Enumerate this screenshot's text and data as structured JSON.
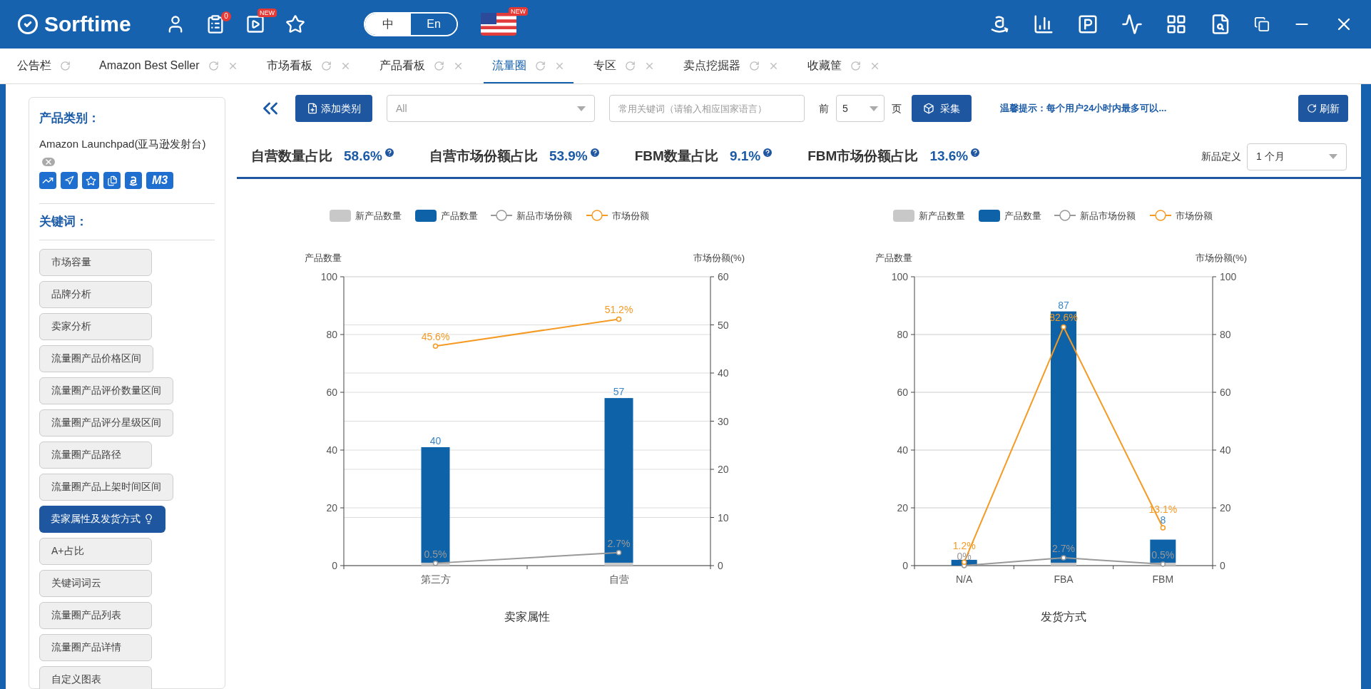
{
  "app": {
    "logo": "Sorftime",
    "notification_count": "0",
    "video_badge": "NEW",
    "languages": [
      {
        "label": "中",
        "selected": true
      },
      {
        "label": "En",
        "selected": false
      }
    ],
    "flag_badge": "NEW"
  },
  "tabs": [
    {
      "label": "公告栏",
      "selected": false,
      "closable": false
    },
    {
      "label": "Amazon Best Seller",
      "selected": false,
      "closable": true
    },
    {
      "label": "市场看板",
      "selected": false,
      "closable": true
    },
    {
      "label": "产品看板",
      "selected": false,
      "closable": true
    },
    {
      "label": "流量圈",
      "selected": true,
      "closable": true
    },
    {
      "label": "专区",
      "selected": false,
      "closable": true
    },
    {
      "label": "卖点挖掘器",
      "selected": false,
      "closable": true
    },
    {
      "label": "收藏筐",
      "selected": false,
      "closable": true
    }
  ],
  "sidebar": {
    "category_heading": "产品类别：",
    "category": "Amazon Launchpad(亚马逊发射台)",
    "tool_badge": "M3",
    "keyword_heading": "关键词：",
    "items": [
      {
        "label": "市场容量",
        "selected": false
      },
      {
        "label": "品牌分析",
        "selected": false
      },
      {
        "label": "卖家分析",
        "selected": false
      },
      {
        "label": "流量圈产品价格区间",
        "selected": false
      },
      {
        "label": "流量圈产品评价数量区间",
        "selected": false
      },
      {
        "label": "流量圈产品评分星级区间",
        "selected": false
      },
      {
        "label": "流量圈产品路径",
        "selected": false
      },
      {
        "label": "流量圈产品上架时间区间",
        "selected": false
      },
      {
        "label": "卖家属性及发货方式",
        "selected": true
      },
      {
        "label": "A+占比",
        "selected": false
      },
      {
        "label": "关键词词云",
        "selected": false
      },
      {
        "label": "流量圈产品列表",
        "selected": false
      },
      {
        "label": "流量圈产品详情",
        "selected": false
      },
      {
        "label": "自定义图表",
        "selected": false
      }
    ]
  },
  "toolbar": {
    "add_button": "添加类别",
    "category_select": "All",
    "keyword_placeholder": "常用关键词（请输入相应国家语言）",
    "pages_prefix": "前",
    "pages_select": "5",
    "pages_suffix": "页",
    "collect_button": "采集",
    "hint": "温馨提示：每个用户24小时内最多可以...",
    "refresh_button": "刷新"
  },
  "stats": [
    {
      "label": "自营数量占比",
      "value": "58.6%"
    },
    {
      "label": "自营市场份额占比",
      "value": "53.9%"
    },
    {
      "label": "FBM数量占比",
      "value": "9.1%"
    },
    {
      "label": "FBM市场份额占比",
      "value": "13.6%"
    }
  ],
  "new_definition": {
    "label": "新品定义",
    "value": "1 个月"
  },
  "charts": [
    {
      "chart_data": {
        "type": "bar",
        "stacked": true,
        "grid": true,
        "legend": "top",
        "xlabel": "卖家属性",
        "ylabel": "产品数量",
        "y2label": "市场份额(%)",
        "categories": [
          "第三方",
          "自营"
        ],
        "ylim": [
          0,
          100
        ],
        "yticks": [
          0,
          20,
          40,
          60,
          80,
          100
        ],
        "y2lim": [
          0,
          60
        ],
        "y2ticks": [
          0,
          10,
          20,
          30,
          40,
          50,
          60
        ],
        "data_labels": true,
        "series": [
          {
            "name": "新产品数量",
            "type": "bar",
            "color": "#c8c8c8",
            "values": [
              1,
              1
            ],
            "value_labels": [
              null,
              null
            ]
          },
          {
            "name": "产品数量",
            "type": "bar",
            "color": "#0d62a8",
            "values": [
              40,
              57
            ],
            "value_labels": [
              "40",
              "57"
            ]
          },
          {
            "name": "新品市场份额",
            "type": "line",
            "axis": "y2",
            "marker": "circle",
            "color": "#999999",
            "values": [
              0.5,
              2.7
            ],
            "value_labels": [
              "0.5%",
              "2.7%"
            ]
          },
          {
            "name": "市场份额",
            "type": "line",
            "axis": "y2",
            "marker": "circle",
            "color": "#f59a23",
            "values": [
              45.6,
              51.2
            ],
            "value_labels": [
              "45.6%",
              "51.2%"
            ]
          }
        ]
      }
    },
    {
      "chart_data": {
        "type": "bar",
        "stacked": true,
        "grid": true,
        "legend": "top",
        "xlabel": "发货方式",
        "ylabel": "产品数量",
        "y2label": "市场份额(%)",
        "categories": [
          "N/A",
          "FBA",
          "FBM"
        ],
        "ylim": [
          0,
          100
        ],
        "yticks": [
          0,
          20,
          40,
          60,
          80,
          100
        ],
        "y2lim": [
          0,
          100
        ],
        "y2ticks": [
          0,
          20,
          40,
          60,
          80,
          100
        ],
        "data_labels": true,
        "series": [
          {
            "name": "新产品数量",
            "type": "bar",
            "color": "#c8c8c8",
            "values": [
              0,
              1,
              1
            ],
            "value_labels": [
              null,
              null,
              null
            ]
          },
          {
            "name": "产品数量",
            "type": "bar",
            "color": "#0d62a8",
            "values": [
              2,
              87,
              8
            ],
            "value_labels": [
              null,
              "87",
              "8"
            ]
          },
          {
            "name": "新品市场份额",
            "type": "line",
            "axis": "y2",
            "marker": "circle",
            "color": "#999999",
            "values": [
              0,
              2.7,
              0.5
            ],
            "value_labels": [
              "0%",
              "2.7%",
              "0.5%"
            ]
          },
          {
            "name": "市场份额",
            "type": "line",
            "axis": "y2",
            "marker": "circle",
            "color": "#f59a23",
            "values": [
              1.2,
              82.6,
              13.1
            ],
            "value_labels": [
              "1.2%",
              "82.6%",
              "13.1%"
            ]
          }
        ]
      }
    }
  ]
}
